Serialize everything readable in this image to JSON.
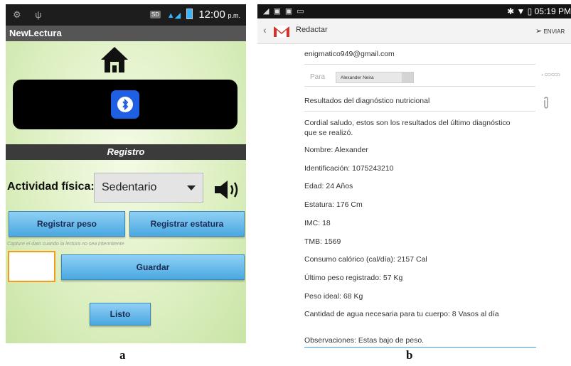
{
  "panel_a": {
    "status_time": "12:00",
    "status_ampm": "p.m.",
    "status_sd": "SD",
    "app_title": "NewLectura",
    "section_title": "Registro",
    "activity_label": "Actividad física:",
    "activity_selected": "Sedentario",
    "btn_peso": "Registrar peso",
    "btn_estatura": "Registrar estatura",
    "hint": "Capture el dato cuando la lectura no sea intermitente",
    "btn_guardar": "Guardar",
    "btn_listo": "Listo",
    "colors": {
      "accent_blue": "#1e5fe3",
      "button": "#6fbcea",
      "input_border": "#f29b1f"
    }
  },
  "panel_b": {
    "status_time": "05:19 PM",
    "title": "Redactar",
    "send_label": "ENVIAR",
    "from": "enigmatico949@gmail.com",
    "to_label": "Para",
    "to_chip": "Alexander Neira",
    "cc_label": "+ CC/CCO",
    "subject": "Resultados del diagnóstico nutricional",
    "body": [
      "Cordial saludo, estos son los resultados del último diagnóstico que se realizó.",
      "Nombre: Alexander",
      "Identificación: 1075243210",
      "Edad: 24 Años",
      "Estatura: 176 Cm",
      "IMC: 18",
      "TMB: 1569",
      "Consumo calórico (cal/día): 2157 Cal",
      "Último peso registrado: 57 Kg",
      "Peso ideal: 68 Kg",
      "Cantidad de agua necesaria para tu cuerpo: 8 Vasos al día"
    ],
    "observaciones": "Observaciones: Estas bajo de peso."
  },
  "captions": {
    "a": "a",
    "b": "b"
  }
}
